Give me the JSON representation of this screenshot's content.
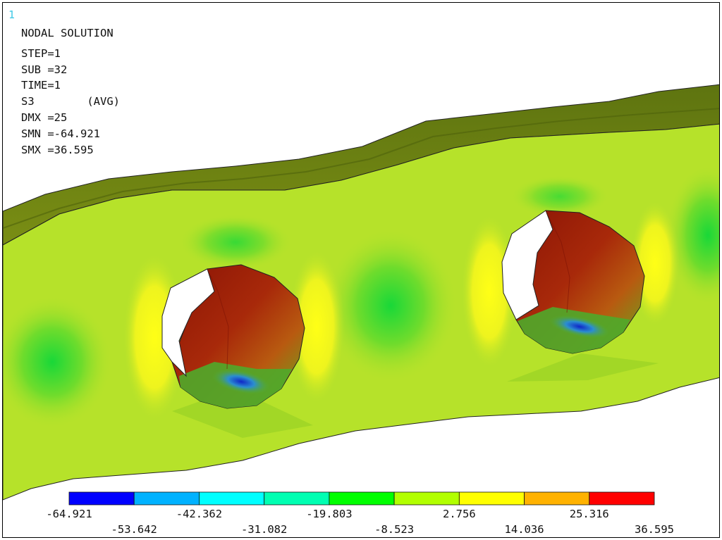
{
  "window_number": "1",
  "plot": {
    "title": "NODAL SOLUTION",
    "info_lines": [
      "STEP=1",
      "SUB =32",
      "TIME=1",
      "S3        (AVG)",
      "DMX =25",
      "SMN =-64.921",
      "SMX =36.595"
    ]
  },
  "legend": {
    "colors": [
      "#0000ff",
      "#00b2ff",
      "#00ffff",
      "#00ffb2",
      "#00ff00",
      "#b2ff00",
      "#ffff00",
      "#ffb200",
      "#ff0000"
    ],
    "labels_top": [
      "-64.921",
      "-42.362",
      "-19.803",
      "2.756",
      "25.316"
    ],
    "labels_bottom": [
      "-53.642",
      "-31.082",
      "-8.523",
      "14.036",
      "36.595"
    ]
  },
  "colors": {
    "top_flange": "#667a10",
    "plate": "#b6e22a",
    "hole_hot": "#9c1f05",
    "hole_cold": "#1d3fb0",
    "green_spot": "#22d93a",
    "yellow_band": "#f3f51a"
  }
}
